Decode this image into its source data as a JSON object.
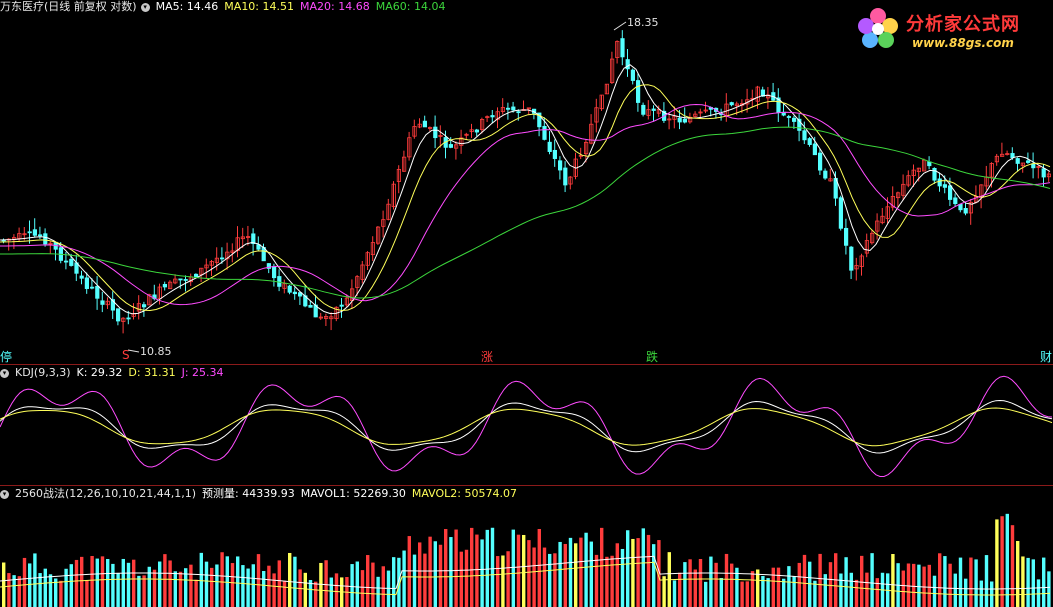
{
  "price": {
    "title": "万东医疗(日线 前复权 对数)",
    "ma5_label": "MA5: 14.46",
    "ma10_label": "MA10: 14.51",
    "ma20_label": "MA20: 14.68",
    "ma60_label": "MA60: 14.04",
    "high_label": "18.35",
    "low_label": "10.85",
    "markers": {
      "ting": "停",
      "s": "S",
      "zhang": "涨",
      "die": "跌",
      "cai": "财"
    }
  },
  "kdj": {
    "name": "KDJ(9,3,3)",
    "k_label": "K: 29.32",
    "d_label": "D: 31.31",
    "j_label": "J: 25.34"
  },
  "volume": {
    "name": "2560战法(12,26,10,10,21,44,1,1)",
    "forecast_label": "预测量: 44339.93",
    "mavol1_label": "MAVOL1: 52269.30",
    "mavol2_label": "MAVOL2: 50574.07"
  },
  "logo": {
    "text": "分析家公式网",
    "url": "www.88gs.com"
  },
  "colors": {
    "up": "#ff3c3c",
    "down": "#54ffff",
    "ma5": "#ffffff",
    "ma10": "#ffff5a",
    "ma20": "#ff4cff",
    "ma60": "#3cd63c",
    "divider": "#8b1a1a"
  }
}
